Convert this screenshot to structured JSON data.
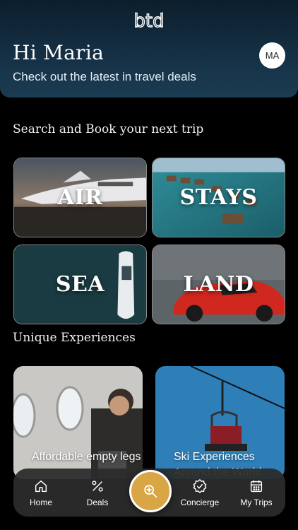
{
  "header": {
    "logo_text": "btd",
    "greeting": "Hi Maria",
    "subtitle": "Check out the latest in travel deals",
    "avatar_initials": "MA"
  },
  "booking_section": {
    "title": "Search and Book your next trip",
    "cards": [
      {
        "label": "AIR"
      },
      {
        "label": "STAYS"
      },
      {
        "label": "SEA"
      },
      {
        "label": "LAND"
      }
    ]
  },
  "experiences_section": {
    "title": "Unique Experiences",
    "cards": [
      {
        "label": "Affordable empty legs"
      },
      {
        "label": "Ski Experiences Around the World"
      }
    ]
  },
  "nav": {
    "items": [
      {
        "label": "Home",
        "icon": "home-icon"
      },
      {
        "label": "Deals",
        "icon": "percent-icon"
      },
      {
        "label": "Concierge",
        "icon": "badge-check-icon"
      },
      {
        "label": "My Trips",
        "icon": "calendar-icon"
      }
    ],
    "search_icon": "search-icon"
  },
  "colors": {
    "accent_gold": "#d9a646",
    "header_bg": "#17344a",
    "nav_bg": "#2c2c2c"
  }
}
